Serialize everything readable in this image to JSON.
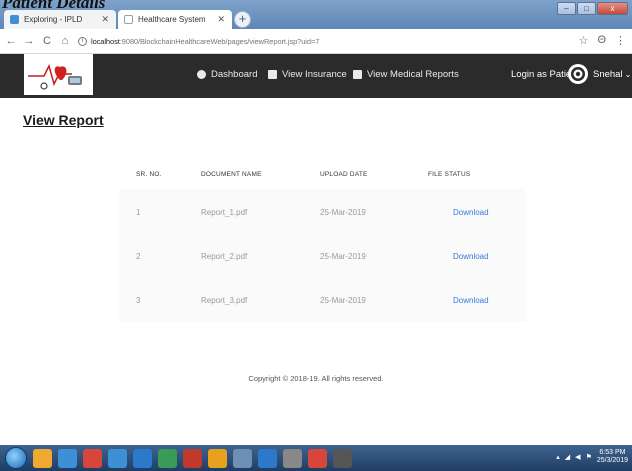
{
  "overlay": {
    "heading": "Patient Details"
  },
  "browser": {
    "tabs": [
      {
        "label": "Exploring - IPLD",
        "color": "#3d8fd6"
      },
      {
        "label": "Healthcare System",
        "color": "#9aa0a6"
      }
    ],
    "new_tab_symbol": "+",
    "window_controls": [
      "–",
      "□",
      "x"
    ],
    "nav": {
      "back": "←",
      "forward": "→",
      "reload": "C",
      "home": "⌂"
    },
    "url_host": "localhost",
    "url_rest": ":9080/BlockchainHealthcareWeb/pages/viewReport.jsp?uid=7",
    "star": "☆",
    "profile": "Θ",
    "menu": "⋮"
  },
  "app": {
    "nav": [
      {
        "label": "Dashboard",
        "icon": "tachometer-icon"
      },
      {
        "label": "View Insurance",
        "icon": "bank-icon"
      },
      {
        "label": "View Medical Reports",
        "icon": "bank-icon"
      }
    ],
    "login_label": "Login as Patient",
    "user_name": "Snehal",
    "user_caret": "⌄"
  },
  "page": {
    "title": "View Report",
    "columns": [
      "SR. NO.",
      "DOCUMENT NAME",
      "UPLOAD DATE",
      "FILE STATUS"
    ],
    "rows": [
      {
        "sr": "1",
        "name": "Report_1.pdf",
        "date": "25-Mar-2019",
        "status": "Download"
      },
      {
        "sr": "2",
        "name": "Report_2.pdf",
        "date": "25-Mar-2019",
        "status": "Download"
      },
      {
        "sr": "3",
        "name": "Report_3.pdf",
        "date": "25-Mar-2019",
        "status": "Download"
      }
    ],
    "footer": "Copyright © 2018-19. All rights reserved."
  },
  "taskbar": {
    "clock_time": "6:53 PM",
    "clock_date": "25/3/2019",
    "colors": [
      "#f0a830",
      "#3d8fd6",
      "#d8453b",
      "#3d8fd6",
      "#2c79c9",
      "#3a9a58",
      "#c0392b",
      "#e7a11e",
      "#6e8fb4",
      "#2c79c9",
      "#888888",
      "#d8453b",
      "#555555"
    ]
  }
}
